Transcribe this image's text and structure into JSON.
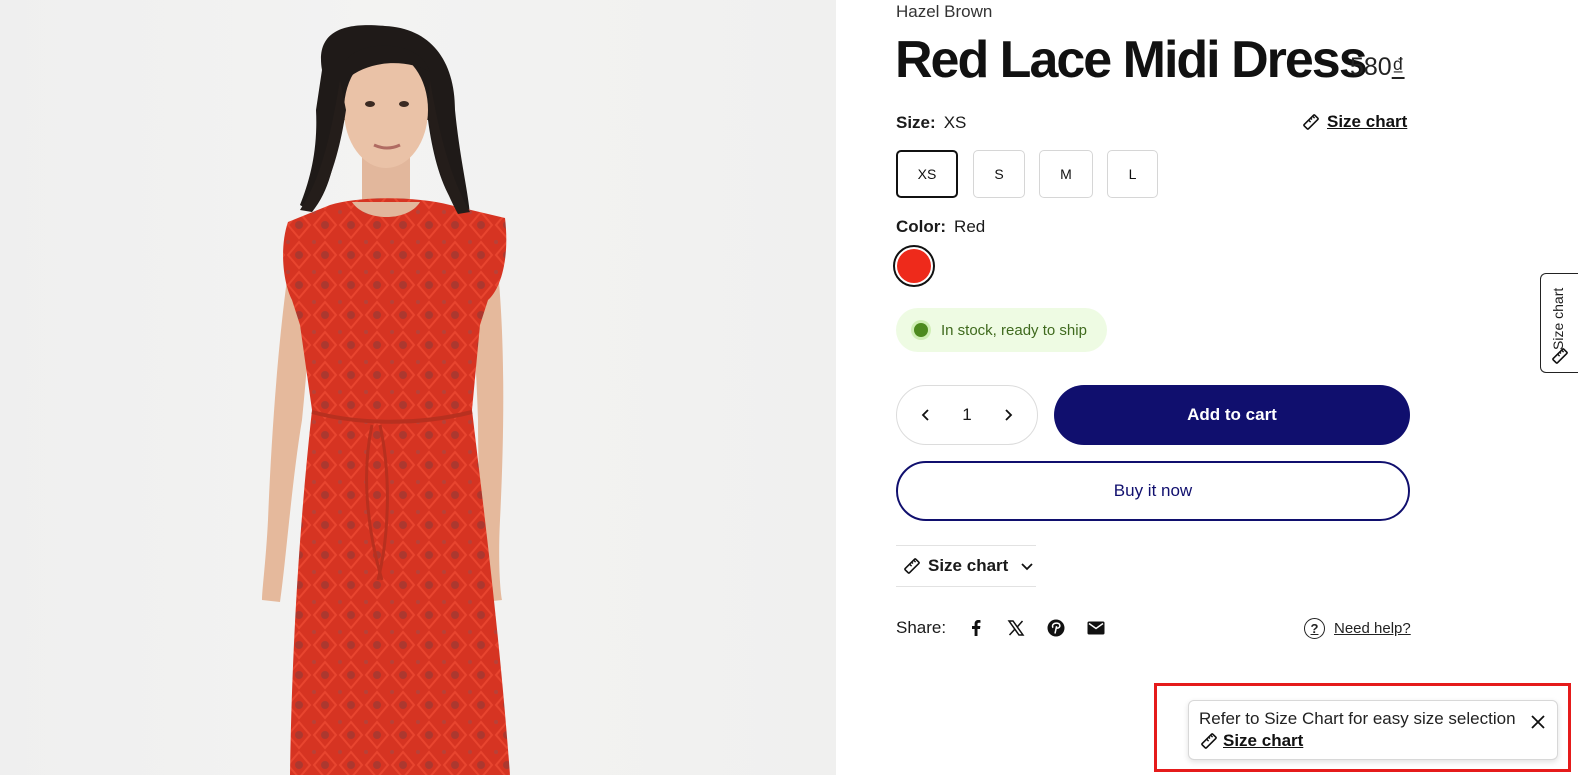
{
  "product": {
    "vendor": "Hazel Brown",
    "title": "Red Lace Midi Dress",
    "price_amount": "580",
    "price_currency": "₫",
    "image_icon": "product-photo-red-lace-dress"
  },
  "size": {
    "label": "Size:",
    "selected": "XS",
    "options": [
      "XS",
      "S",
      "M",
      "L"
    ],
    "chart_link": "Size chart"
  },
  "color": {
    "label": "Color:",
    "selected": "Red",
    "swatch_hex": "#ee2a1b"
  },
  "stock": {
    "text": "In stock, ready to ship",
    "dot_color": "#4d8a1e"
  },
  "quantity": {
    "value": "1"
  },
  "actions": {
    "add_to_cart": "Add to cart",
    "buy_now": "Buy it now",
    "brand_color": "#100f6e"
  },
  "accordion": {
    "label": "Size chart"
  },
  "share": {
    "label": "Share:",
    "icons": [
      "facebook-icon",
      "x-twitter-icon",
      "pinterest-icon",
      "email-icon"
    ]
  },
  "help": {
    "label": "Need help?"
  },
  "side_tab": {
    "label": "Size chart"
  },
  "toast": {
    "message": "Refer to Size Chart for easy size selection",
    "link": "Size chart",
    "highlight_color": "#e51b1b"
  }
}
